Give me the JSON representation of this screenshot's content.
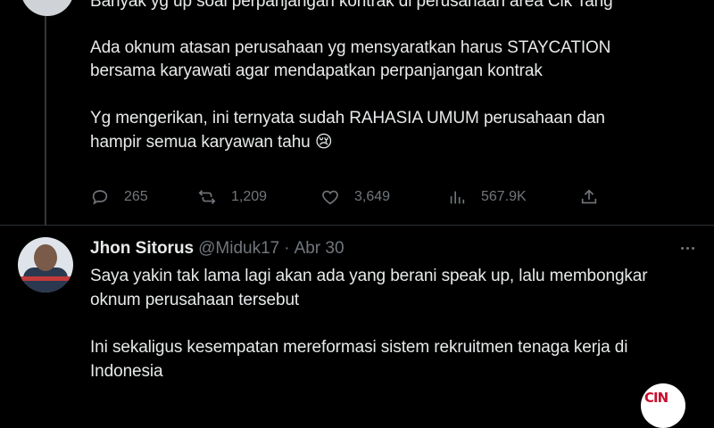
{
  "tweet1": {
    "lines": [
      "Banyak yg up soal perpanjangan kontrak di perusahaan area Cik Tang",
      "Ada oknum atasan perusahaan yg mensyaratkan harus STAYCATION",
      "bersama karyawati agar mendapatkan perpanjangan kontrak",
      "Yg mengerikan, ini ternyata sudah RAHASIA UMUM perusahaan dan",
      "hampir semua karyawan tahu 😢"
    ],
    "actions": {
      "replies": "265",
      "reposts": "1,209",
      "likes": "3,649",
      "views": "567.9K"
    }
  },
  "tweet2": {
    "name": "Jhon Sitorus",
    "handle": "@Miduk17",
    "separator": "·",
    "date": "Abr 30",
    "lines": [
      "Saya yakin tak lama lagi akan ada yang berani speak up, lalu membongkar",
      "oknum perusahaan tersebut",
      "Ini sekaligus kesempatan mereformasi sistem rekruitmen tenaga kerja di",
      "Indonesia"
    ]
  },
  "watermark": {
    "text": "CIN"
  },
  "colors": {
    "background": "#000000",
    "text": "#e7e9ea",
    "muted": "#71767b",
    "divider": "#2f3336"
  }
}
